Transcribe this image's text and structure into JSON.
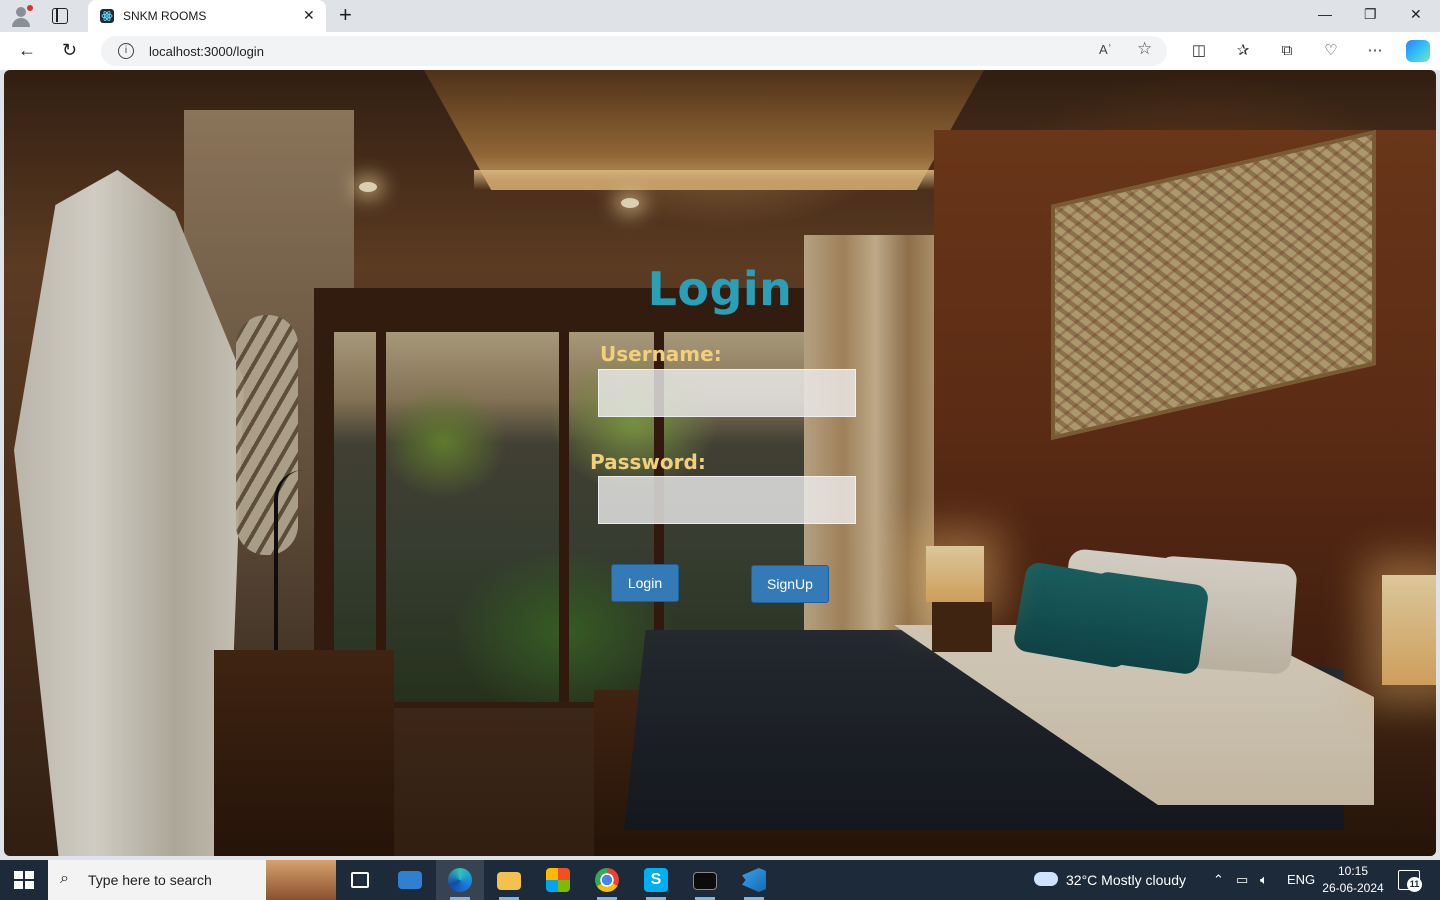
{
  "browser": {
    "tab_title": "SNKM ROOMS",
    "tab_close": "✕",
    "new_tab": "+",
    "url": "localhost:3000/login",
    "read_aloud": "Aʾ",
    "window_controls": {
      "minimize": "—",
      "restore": "❐",
      "close": "✕"
    }
  },
  "page": {
    "heading": "Login",
    "username_label": "Username:",
    "username_value": "",
    "password_label": "Password:",
    "password_value": "",
    "login_button": "Login",
    "signup_button": "SignUp",
    "title_color": "#2aa0b8",
    "label_color": "#f1cf7c",
    "button_color": "#337ab7"
  },
  "taskbar": {
    "search_placeholder": "Type here to search",
    "weather": "32°C  Mostly cloudy",
    "language": "ENG",
    "time": "10:15",
    "date": "26-06-2024",
    "notification_count": "11",
    "apps": [
      "task-view-icon",
      "mail-icon",
      "edge-icon",
      "file-explorer-icon",
      "microsoft-store-icon",
      "chrome-icon",
      "skype-icon",
      "terminal-icon",
      "vscode-icon"
    ]
  }
}
